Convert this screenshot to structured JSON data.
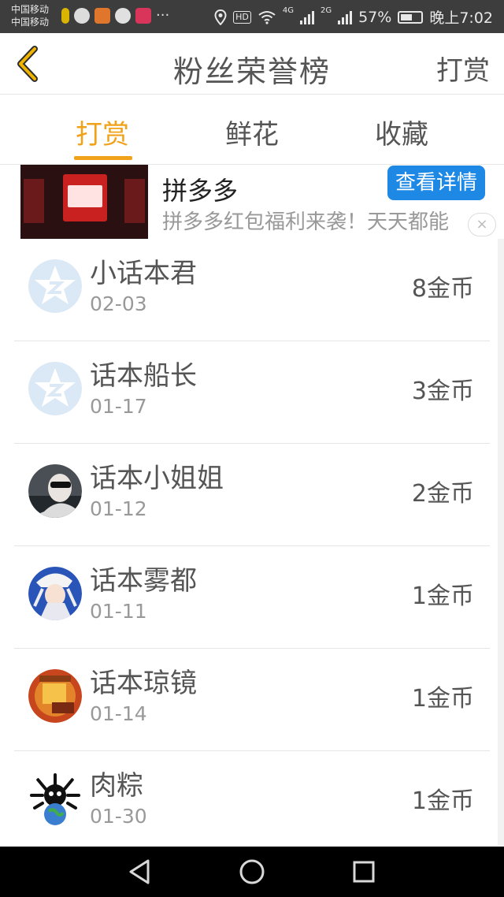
{
  "status_bar": {
    "carrier_1": "中国移动",
    "carrier_2": "中国移动",
    "network_1": "4G",
    "network_2": "2G",
    "hd_badge": "HD",
    "battery": "57%",
    "time": "晚上7:02",
    "more": "···"
  },
  "header": {
    "title": "粉丝荣誉榜",
    "action_label": "打赏"
  },
  "tabs": [
    {
      "label": "打赏",
      "active": true
    },
    {
      "label": "鲜花",
      "active": false
    },
    {
      "label": "收藏",
      "active": false
    }
  ],
  "ad": {
    "name": "拼多多",
    "description": "拼多多红包福利来袭！天天都能",
    "button_label": "查看详情",
    "close_symbol": "×"
  },
  "supporters": [
    {
      "name": "小话本君",
      "date": "02-03",
      "amount": "8金币",
      "avatar": "default-star-avatar"
    },
    {
      "name": "话本船长",
      "date": "01-17",
      "amount": "3金币",
      "avatar": "default-star-avatar"
    },
    {
      "name": "话本小姐姐",
      "date": "01-12",
      "amount": "2金币",
      "avatar": "photo-avatar-sunglasses"
    },
    {
      "name": "话本雾都",
      "date": "01-11",
      "amount": "1金币",
      "avatar": "photo-avatar-anime-blue"
    },
    {
      "name": "话本琼镜",
      "date": "01-14",
      "amount": "1金币",
      "avatar": "photo-avatar-red-orange"
    },
    {
      "name": "肉粽",
      "date": "01-30",
      "amount": "1金币",
      "avatar": "photo-avatar-globe-cartoon"
    }
  ],
  "colors": {
    "accent": "#f0a21a",
    "ad_button": "#1e88e5",
    "status_bar": "#3d3d3d",
    "nav_bar": "#000000"
  }
}
